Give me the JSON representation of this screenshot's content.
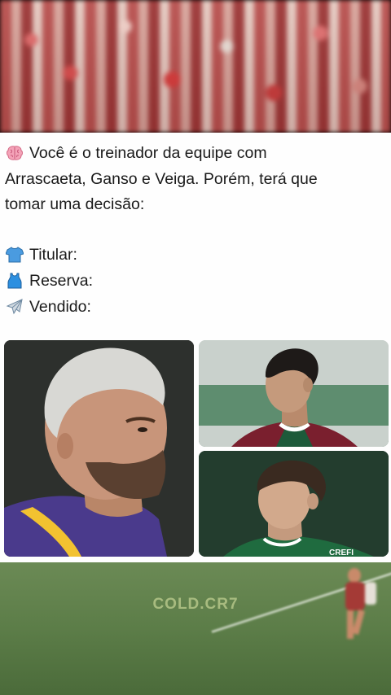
{
  "post": {
    "line1": "Você é o treinador da equipe com",
    "line2": "Arrascaeta, Ganso e Veiga. Porém, terá que",
    "line3": "tomar uma decisão:",
    "options": [
      {
        "icon": "t-shirt-icon",
        "label": "Titular:"
      },
      {
        "icon": "tank-top-icon",
        "label": "Reserva:"
      },
      {
        "icon": "airplane-icon",
        "label": "Vendido:"
      }
    ],
    "brain_icon": "brain-icon"
  },
  "photos": {
    "left_player_name": "Arrascaeta",
    "top_right_player_name": "Ganso",
    "bottom_right_player_name": "Veiga",
    "left_kit_colors": [
      "#4a3a8c",
      "#f2c230"
    ],
    "top_right_kit_colors": [
      "#7a1f2e",
      "#ffffff",
      "#1d5a3a"
    ],
    "bottom_right_kit_colors": [
      "#1f6b3f",
      "#ffffff"
    ],
    "bottom_right_kit_text": "CREFI"
  },
  "watermark": {
    "text": "COLD.CR7"
  },
  "colors": {
    "card_bg": "#fefefe",
    "text": "#1a1a1a",
    "pitch": "#5c7d48"
  }
}
